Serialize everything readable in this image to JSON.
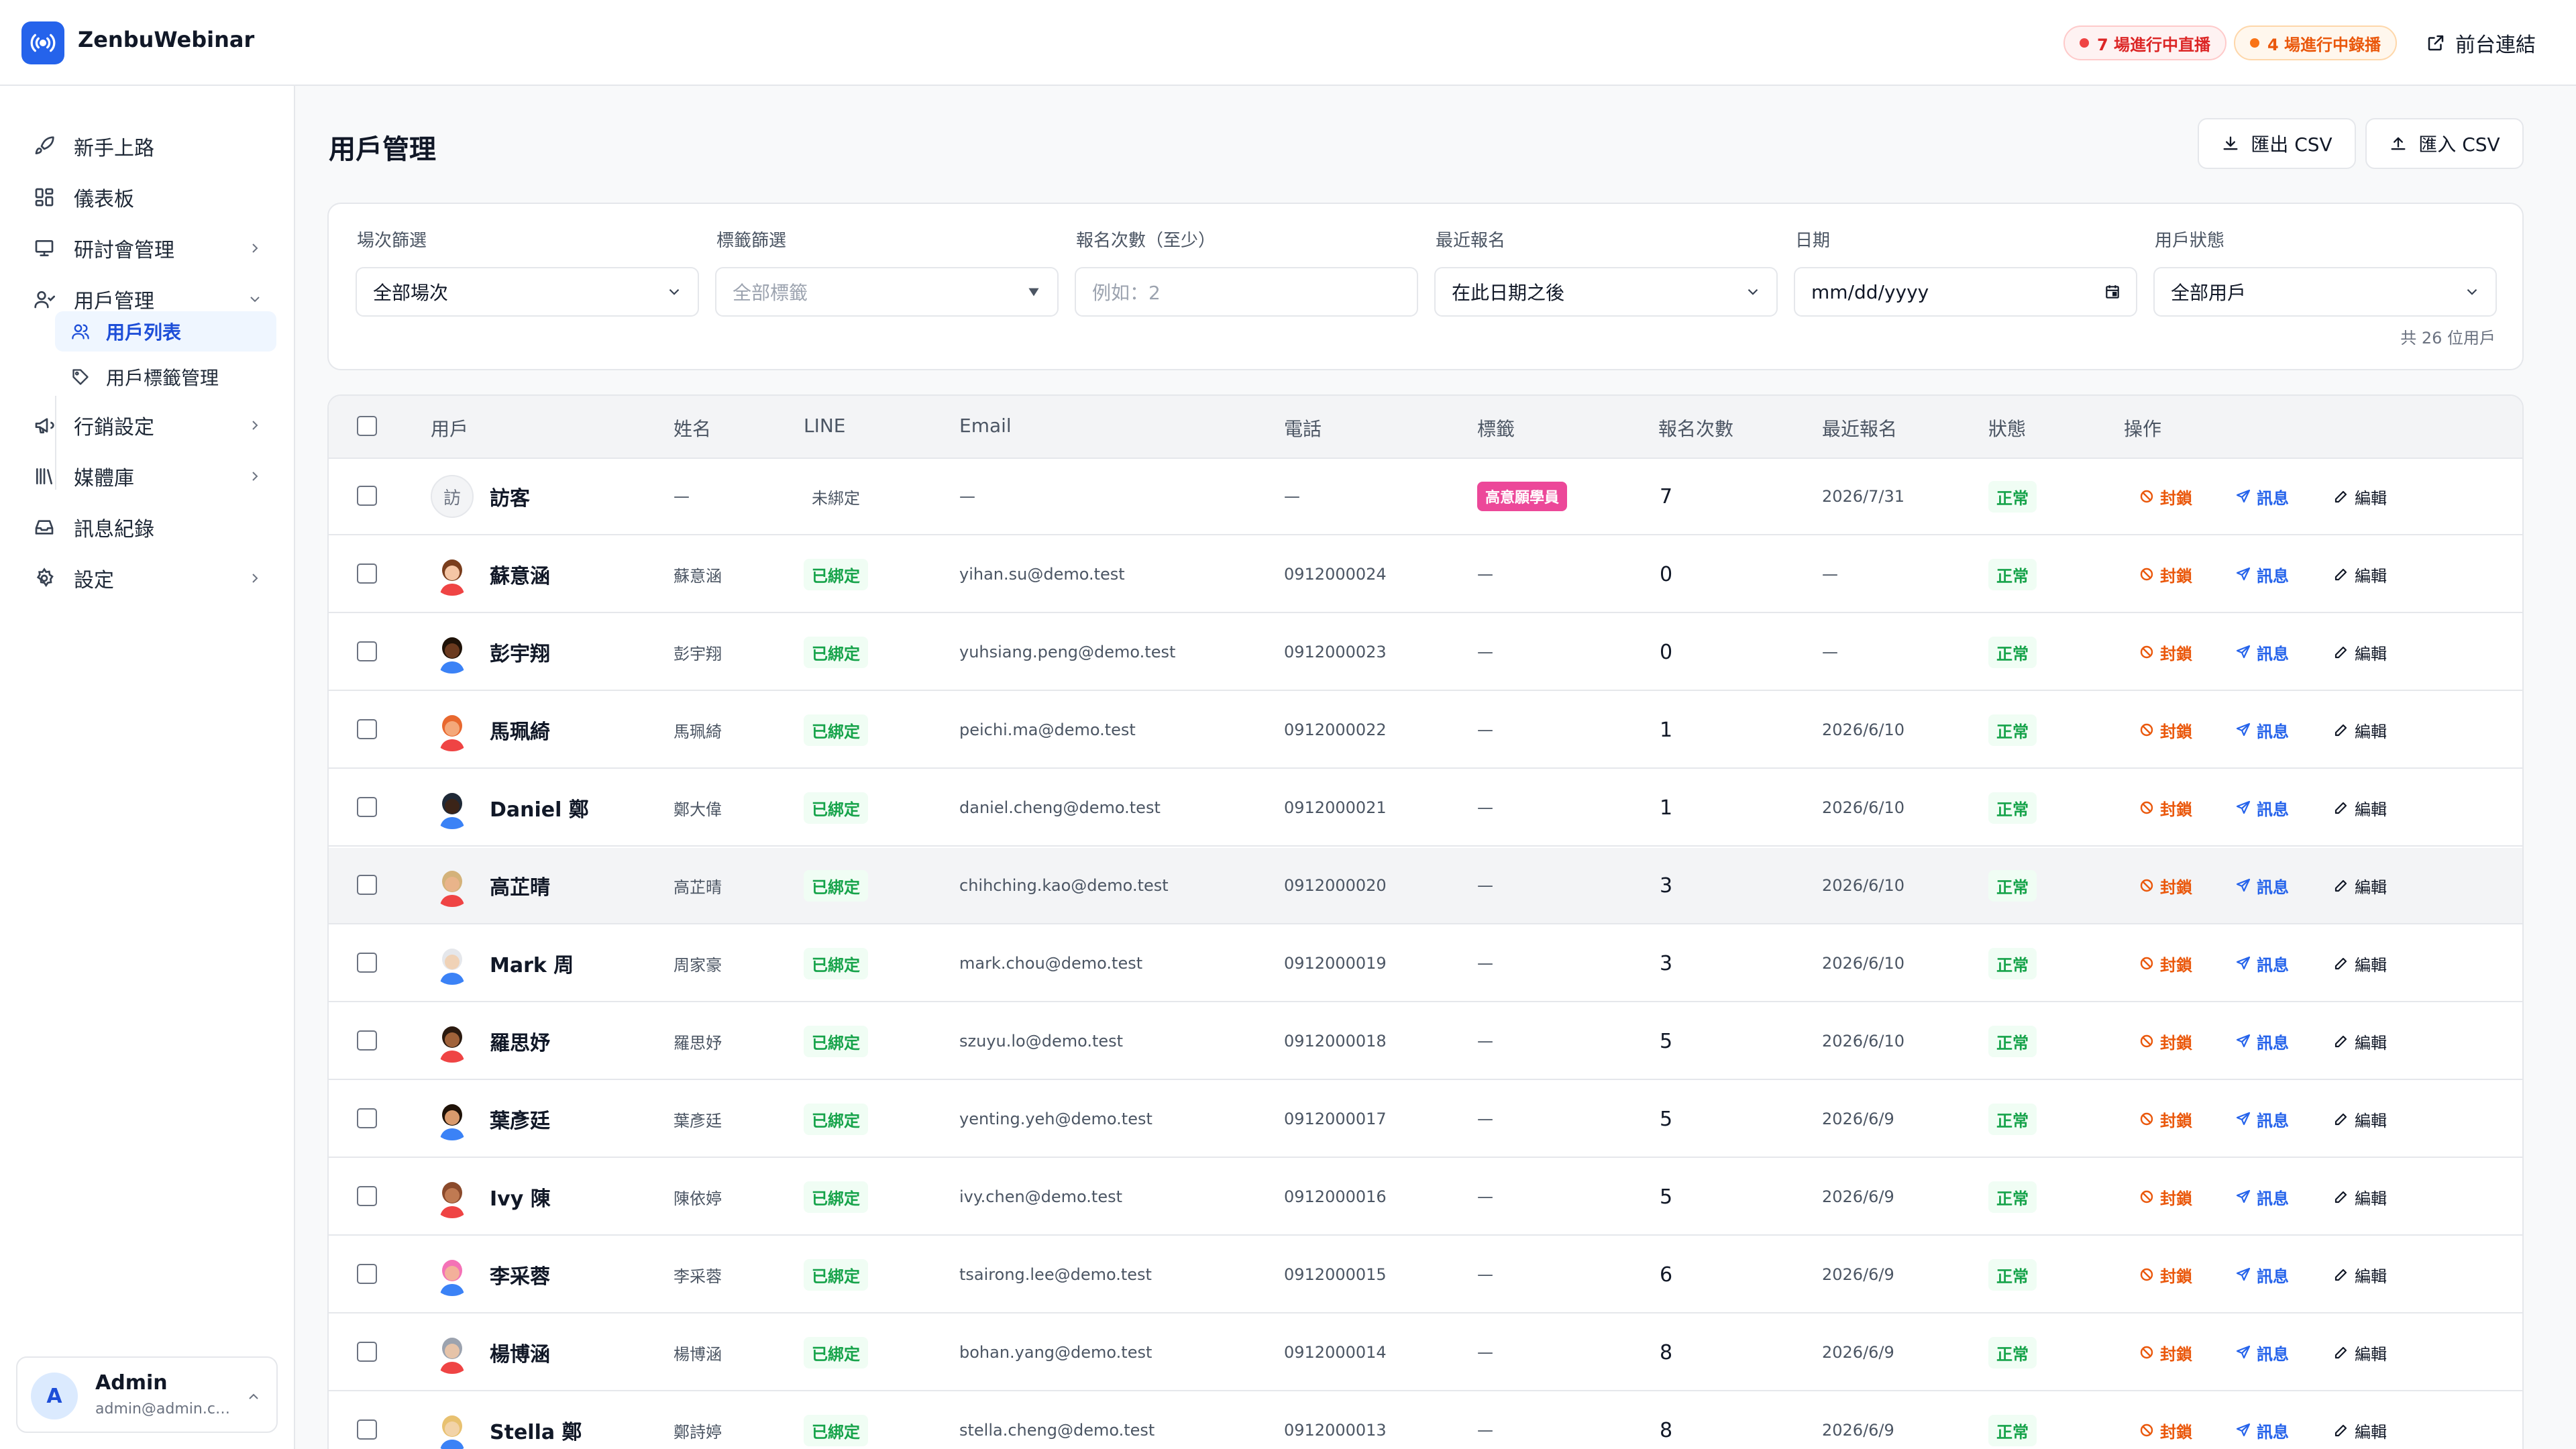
{
  "app": {
    "name": "ZenbuWebinar"
  },
  "topbar": {
    "live_label": "7 場進行中直播",
    "replay_label": "4 場進行中錄播",
    "front_link": "前台連結"
  },
  "sidebar": {
    "items": [
      {
        "label": "新手上路",
        "icon": "rocket-icon"
      },
      {
        "label": "儀表板",
        "icon": "dashboard-icon"
      },
      {
        "label": "研討會管理",
        "icon": "presentation-icon"
      },
      {
        "label": "用戶管理",
        "icon": "users-icon"
      },
      {
        "label": "行銷設定",
        "icon": "megaphone-icon"
      },
      {
        "label": "媒體庫",
        "icon": "library-icon"
      },
      {
        "label": "訊息紀錄",
        "icon": "inbox-icon"
      },
      {
        "label": "設定",
        "icon": "gear-icon"
      }
    ],
    "sub_items": [
      {
        "label": "用戶列表",
        "icon": "users-icon",
        "active": true
      },
      {
        "label": "用戶標籤管理",
        "icon": "tag-icon",
        "active": false
      }
    ],
    "user": {
      "initial": "A",
      "name": "Admin",
      "email": "admin@admin.co..."
    }
  },
  "page": {
    "title": "用戶管理",
    "export_label": "匯出 CSV",
    "import_label": "匯入 CSV"
  },
  "filters": {
    "session": {
      "label": "場次篩選",
      "value": "全部場次"
    },
    "tag": {
      "label": "標籤篩選",
      "value": "全部標籤"
    },
    "count": {
      "label": "報名次數（至少）",
      "placeholder": "例如：2"
    },
    "recent": {
      "label": "最近報名",
      "value": "在此日期之後"
    },
    "date": {
      "label": "日期",
      "value": "mm/dd/yyyy"
    },
    "status": {
      "label": "用戶狀態",
      "value": "全部用戶"
    },
    "total": "共 26 位用戶"
  },
  "table": {
    "headers": {
      "user": "用戶",
      "name": "姓名",
      "line": "LINE",
      "email": "Email",
      "phone": "電話",
      "tag": "標籤",
      "count": "報名次數",
      "recent": "最近報名",
      "status": "狀態",
      "actions": "操作"
    },
    "actions": {
      "block": "封鎖",
      "message": "訊息",
      "edit": "編輯"
    },
    "rows": [
      {
        "display": "訪客",
        "name": "—",
        "line": "未綁定",
        "email": "—",
        "phone": "—",
        "tag": "高意願學員",
        "count": "7",
        "recent": "2026/7/31",
        "status": "正常",
        "avatar": "訪"
      },
      {
        "display": "蘇意涵",
        "name": "蘇意涵",
        "line": "已綁定",
        "email": "yihan.su@demo.test",
        "phone": "0912000024",
        "tag": "—",
        "count": "0",
        "recent": "—",
        "status": "正常"
      },
      {
        "display": "彭宇翔",
        "name": "彭宇翔",
        "line": "已綁定",
        "email": "yuhsiang.peng@demo.test",
        "phone": "0912000023",
        "tag": "—",
        "count": "0",
        "recent": "—",
        "status": "正常"
      },
      {
        "display": "馬珮綺",
        "name": "馬珮綺",
        "line": "已綁定",
        "email": "peichi.ma@demo.test",
        "phone": "0912000022",
        "tag": "—",
        "count": "1",
        "recent": "2026/6/10",
        "status": "正常"
      },
      {
        "display": "Daniel 鄭",
        "name": "鄭大偉",
        "line": "已綁定",
        "email": "daniel.cheng@demo.test",
        "phone": "0912000021",
        "tag": "—",
        "count": "1",
        "recent": "2026/6/10",
        "status": "正常"
      },
      {
        "display": "高芷晴",
        "name": "高芷晴",
        "line": "已綁定",
        "email": "chihching.kao@demo.test",
        "phone": "0912000020",
        "tag": "—",
        "count": "3",
        "recent": "2026/6/10",
        "status": "正常"
      },
      {
        "display": "Mark 周",
        "name": "周家豪",
        "line": "已綁定",
        "email": "mark.chou@demo.test",
        "phone": "0912000019",
        "tag": "—",
        "count": "3",
        "recent": "2026/6/10",
        "status": "正常"
      },
      {
        "display": "羅思妤",
        "name": "羅思妤",
        "line": "已綁定",
        "email": "szuyu.lo@demo.test",
        "phone": "0912000018",
        "tag": "—",
        "count": "5",
        "recent": "2026/6/10",
        "status": "正常"
      },
      {
        "display": "葉彥廷",
        "name": "葉彥廷",
        "line": "已綁定",
        "email": "yenting.yeh@demo.test",
        "phone": "0912000017",
        "tag": "—",
        "count": "5",
        "recent": "2026/6/9",
        "status": "正常"
      },
      {
        "display": "Ivy 陳",
        "name": "陳依婷",
        "line": "已綁定",
        "email": "ivy.chen@demo.test",
        "phone": "0912000016",
        "tag": "—",
        "count": "5",
        "recent": "2026/6/9",
        "status": "正常"
      },
      {
        "display": "李采蓉",
        "name": "李采蓉",
        "line": "已綁定",
        "email": "tsairong.lee@demo.test",
        "phone": "0912000015",
        "tag": "—",
        "count": "6",
        "recent": "2026/6/9",
        "status": "正常"
      },
      {
        "display": "楊博涵",
        "name": "楊博涵",
        "line": "已綁定",
        "email": "bohan.yang@demo.test",
        "phone": "0912000014",
        "tag": "—",
        "count": "8",
        "recent": "2026/6/9",
        "status": "正常"
      },
      {
        "display": "Stella 鄭",
        "name": "鄭詩婷",
        "line": "已綁定",
        "email": "stella.cheng@demo.test",
        "phone": "0912000013",
        "tag": "—",
        "count": "8",
        "recent": "2026/6/9",
        "status": "正常"
      }
    ]
  },
  "colors": {
    "accent": "#2563eb",
    "success": "#16a34a",
    "danger": "#dc2626",
    "warning": "#ea580c",
    "tag_pink": "#ec4899"
  }
}
